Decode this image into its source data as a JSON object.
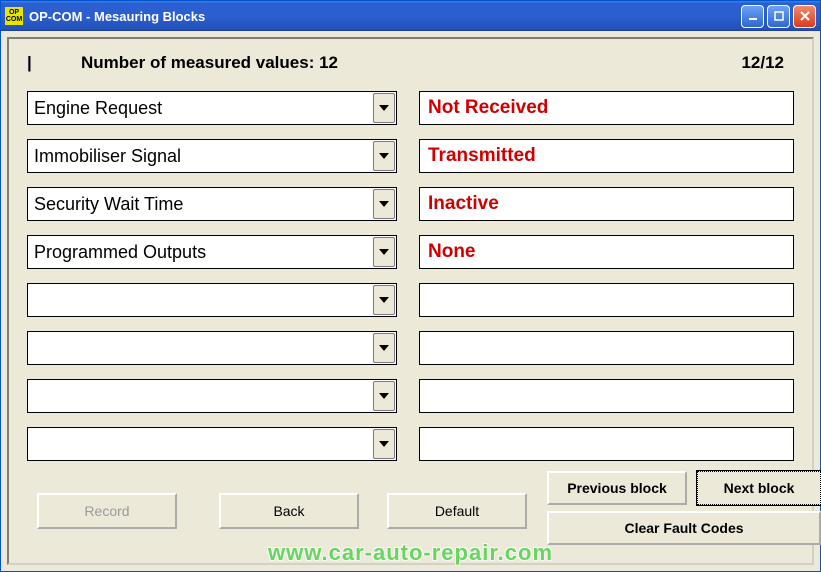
{
  "window": {
    "title": "OP-COM - Mesauring Blocks",
    "icon_label": "OP\nCOM"
  },
  "header": {
    "index": "|",
    "label": "Number of measured values: 12",
    "page": "12/12"
  },
  "slots": [
    {
      "param": "Engine Request",
      "value": "Not Received"
    },
    {
      "param": "Immobiliser Signal",
      "value": "Transmitted"
    },
    {
      "param": "Security Wait Time",
      "value": "Inactive"
    },
    {
      "param": "Programmed Outputs",
      "value": "None"
    },
    {
      "param": "",
      "value": ""
    },
    {
      "param": "",
      "value": ""
    },
    {
      "param": "",
      "value": ""
    },
    {
      "param": "",
      "value": ""
    }
  ],
  "buttons": {
    "record": "Record",
    "back": "Back",
    "default": "Default",
    "prev": "Previous block",
    "next": "Next block",
    "clear": "Clear Fault Codes"
  },
  "watermark": "www.car-auto-repair.com"
}
